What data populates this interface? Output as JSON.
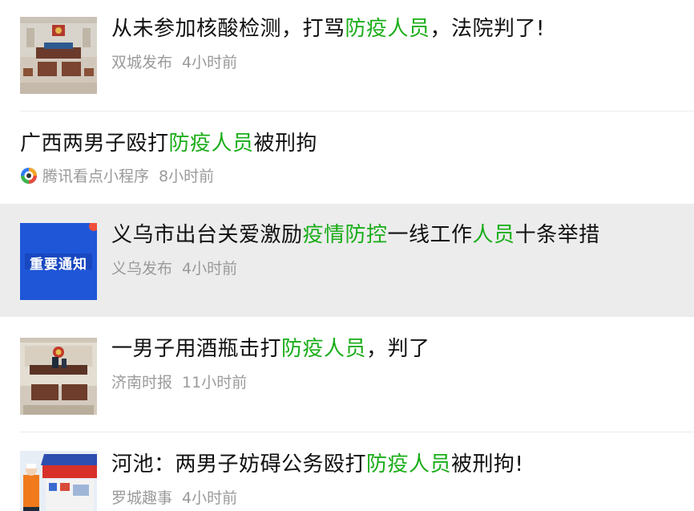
{
  "results": [
    {
      "title_parts": [
        "从未参加核酸检测，打骂",
        "防疫人员",
        "，法院判了!"
      ],
      "source": "双城发布",
      "time": "4小时前",
      "thumbnail": "courtroom-photo"
    },
    {
      "title_parts": [
        "广西两男子殴打",
        "防疫人员",
        "被刑拘"
      ],
      "source": "腾讯看点小程序",
      "time": "8小时前",
      "source_icon": "tencent-kandian-eye-icon"
    },
    {
      "title_parts": [
        "义乌市出台关爱激励",
        "疫情防控",
        "一线工作",
        "人员",
        "十条举措"
      ],
      "source": "义乌发布",
      "time": "4小时前",
      "thumbnail": "重要通知",
      "highlight_color": "#ececec"
    },
    {
      "title_parts": [
        "一男子用酒瓶击打",
        "防疫人员",
        "，判了"
      ],
      "source": "济南时报",
      "time": "11小时前",
      "thumbnail": "courtroom-photo"
    },
    {
      "title_parts": [
        "河池：两男子妨碍公务殴打",
        "防疫人员",
        "被刑拘!"
      ],
      "source": "罗城趣事",
      "time": "4小时前",
      "thumbnail": "checkpoint-tent-photo"
    }
  ],
  "colors": {
    "keyword_highlight": "#1aad19",
    "title_text": "#111111",
    "meta_text": "#9a9a9a",
    "selected_row_bg": "#ececec"
  }
}
